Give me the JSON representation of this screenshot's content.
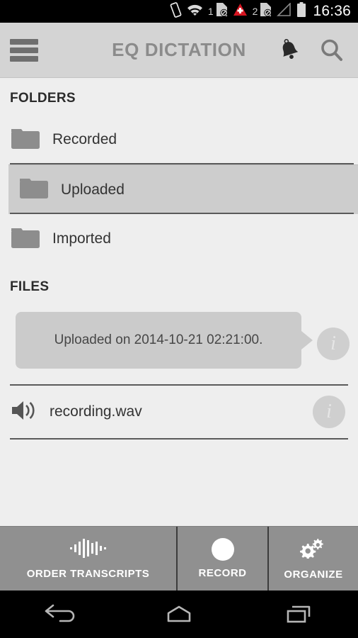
{
  "status_bar": {
    "icons": [
      "vibrate-icon",
      "wifi-icon",
      "sim1-disabled-icon",
      "emergency-alert-icon",
      "sim2-disabled-icon",
      "signal-icon",
      "battery-icon"
    ],
    "sim1_label": "1",
    "sim2_label": "2",
    "clock": "16:36",
    "background": "#000000"
  },
  "app_bar": {
    "title": "EQ DICTATION",
    "menu_icon": "hamburger-menu-icon",
    "bell_icon": "bell-icon",
    "search_icon": "search-icon",
    "background": "#d4d4d4",
    "title_color": "#8b8b8b"
  },
  "folders": {
    "section_label": "FOLDERS",
    "items": [
      {
        "label": "Recorded",
        "selected": false
      },
      {
        "label": "Uploaded",
        "selected": true
      },
      {
        "label": "Imported",
        "selected": false
      }
    ]
  },
  "files": {
    "section_label": "FILES",
    "tooltip": {
      "text": "Uploaded on 2014-10-21 02:21:00.",
      "background": "#cbcbcb"
    },
    "info_icon": "info-icon",
    "items": [
      {
        "name": "recording.wav",
        "icon": "speaker-icon",
        "info_icon": "info-icon"
      }
    ]
  },
  "bottom_bar": {
    "background": "#909090",
    "buttons": [
      {
        "label": "ORDER TRANSCRIPTS",
        "icon": "waveform-icon"
      },
      {
        "label": "RECORD",
        "icon": "record-dot-icon"
      },
      {
        "label": "ORGANIZE",
        "icon": "gears-icon"
      }
    ]
  },
  "nav_bar": {
    "back_icon": "back-arrow-icon",
    "home_icon": "home-icon",
    "recents_icon": "recents-icon",
    "background": "#000000"
  }
}
